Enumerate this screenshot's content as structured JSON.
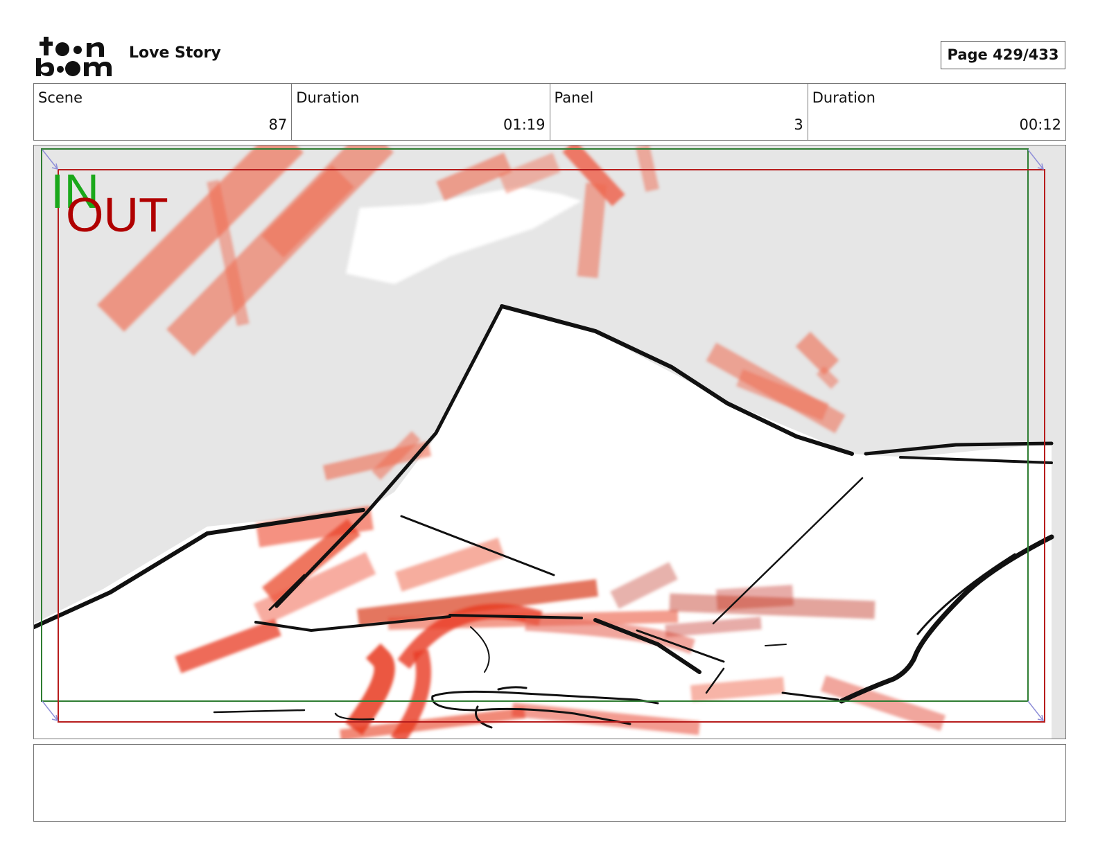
{
  "header": {
    "logo_name": "toon-boom-logo",
    "project_title": "Love Story",
    "page_label": "Page 429/433"
  },
  "info": {
    "scene_label": "Scene",
    "scene_value": "87",
    "scene_duration_label": "Duration",
    "scene_duration_value": "01:19",
    "panel_label": "Panel",
    "panel_value": "3",
    "panel_duration_label": "Duration",
    "panel_duration_value": "00:12"
  },
  "panel": {
    "in_label": "IN",
    "out_label": "OUT",
    "colors": {
      "background": "#e6e6e6",
      "sketch_red": "#ef6a4f",
      "in_frame": "#2e7d32",
      "out_frame": "#b71c1c",
      "in_text": "#1aa81a",
      "out_text": "#b00000"
    }
  },
  "notes": {
    "text": ""
  }
}
